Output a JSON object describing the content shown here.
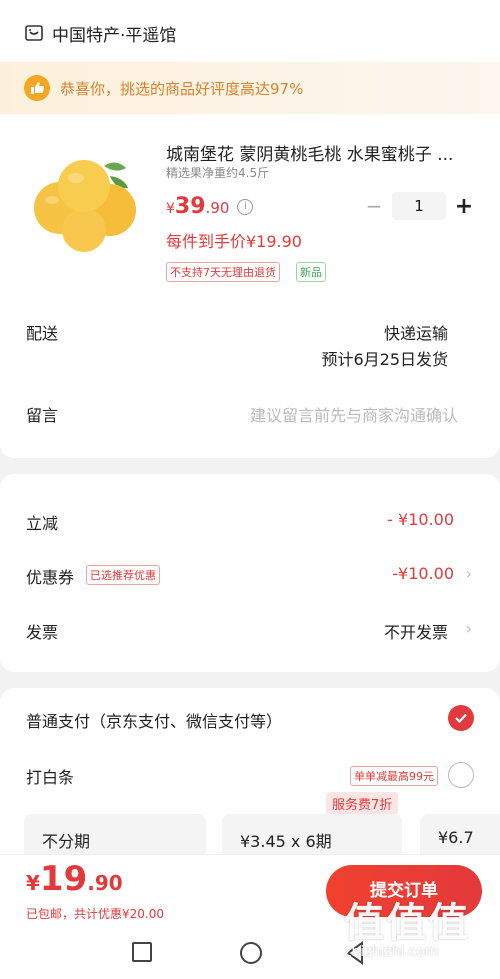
{
  "shop": {
    "name": "中国特产·平遥馆",
    "banner_text": "恭喜你，挑选的商品好评度高达97%"
  },
  "product": {
    "title": "城南堡花 蒙阴黄桃毛桃 水果蜜桃子 ...",
    "spec": "精选果净重约4.5斤",
    "price_symbol": "¥",
    "price_int": "39",
    "price_dec": ".90",
    "unit_price": "每件到手价¥19.90",
    "tag_return": "不支持7天无理由退货",
    "tag_new": "新品",
    "quantity": "1"
  },
  "delivery": {
    "label": "配送",
    "method": "快递运输",
    "eta": "预计6月25日发货"
  },
  "message": {
    "label": "留言",
    "placeholder": "建议留言前先与商家沟通确认"
  },
  "discounts": {
    "instant_label": "立减",
    "instant_value": "- ¥10.00",
    "coupon_label": "优惠券",
    "coupon_tag": "已选推荐优惠",
    "coupon_value": "-¥10.00",
    "invoice_label": "发票",
    "invoice_value": "不开发票"
  },
  "payment": {
    "normal_label": "普通支付（京东支付、微信支付等）",
    "baitiao_label": "打白条",
    "baitiao_promo": "单单减最高99元",
    "plan_badge": "服务费7折",
    "plans": [
      {
        "label": "不分期"
      },
      {
        "label": "¥3.45 x 6期"
      },
      {
        "label": "¥6.7"
      }
    ]
  },
  "footer": {
    "total_symbol": "¥",
    "total_int": "19",
    "total_dec": ".90",
    "shipping_note": "已包邮",
    "discount_note": "，共计优惠¥20.00",
    "submit_label": "提交订单"
  },
  "watermark": {
    "main": "值值值",
    "url": "zhizhizhi.com"
  },
  "colors": {
    "accent": "#e4393c",
    "banner_text": "#d9822b",
    "background": "#f2f2f2"
  }
}
